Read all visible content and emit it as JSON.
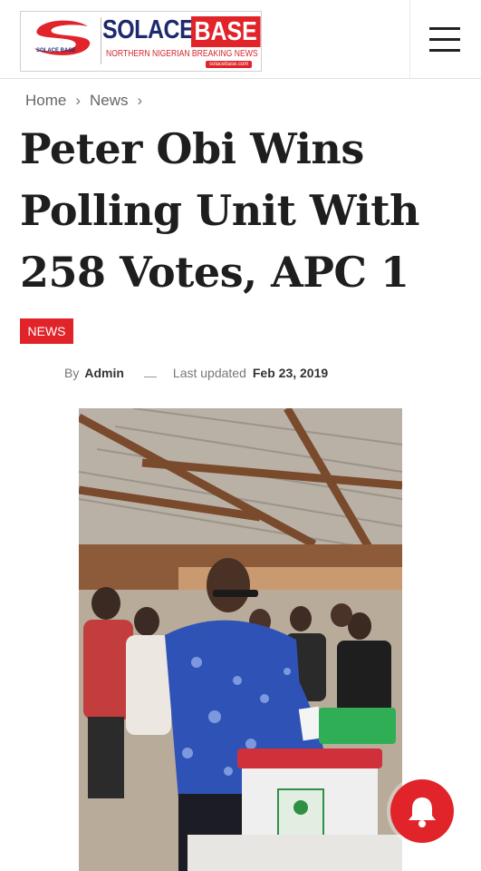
{
  "header": {
    "logo_mark_text": "SOLACE BASE",
    "logo_solace": "SOLACE",
    "logo_base": "BASE",
    "logo_tagline": "NORTHERN NIGERIAN BREAKING NEWS",
    "logo_url": "solacebase.com",
    "menu_icon": "hamburger-menu-icon"
  },
  "breadcrumb": {
    "items": [
      "Home",
      "News"
    ],
    "separator": "›"
  },
  "article": {
    "title": "Peter Obi Wins Polling Unit With 258 Votes, APC 1",
    "category": "NEWS",
    "by_label": "By",
    "author": "Admin",
    "updated_label": "Last updated",
    "updated_date": "Feb 23, 2019"
  },
  "notification": {
    "icon": "bell-icon"
  },
  "colors": {
    "accent": "#e0242a",
    "brand_navy": "#1d2a6e",
    "title": "#1e1e1e"
  }
}
